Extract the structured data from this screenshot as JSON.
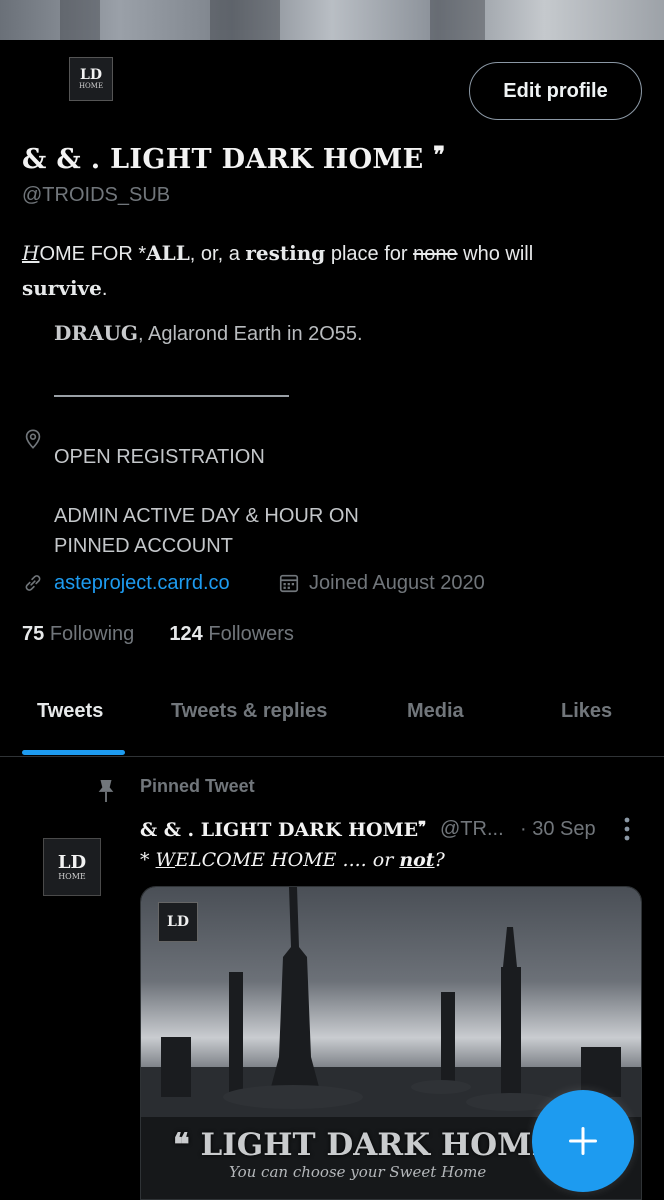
{
  "profile": {
    "avatar_text_large": "LD",
    "avatar_text_small": "HOME",
    "edit_button": "Edit profile",
    "name": "& & . LIGHT DARK HOME",
    "name_mark": "❞",
    "handle": "@TROIDS_SUB",
    "bio": {
      "l1_a": "H",
      "l1_b": "OME FOR *",
      "l1_c": "ALL",
      "l1_d": ", or, a ",
      "l1_e": "resting",
      "l1_f": " place for ",
      "l1_g": "none",
      "l1_h": " who will ",
      "l2_a": "survive",
      "l2_b": ".",
      "l3_a": "DRAUG",
      "l3_b": ",  Aglarond Earth  in  2O55.",
      "location_1": "OPEN REGISTRATION",
      "location_2": "ADMIN ACTIVE DAY & HOUR ON",
      "location_3": "PINNED ACCOUNT"
    },
    "link": "asteproject.carrd.co",
    "joined": "Joined August 2020",
    "following_count": "75",
    "following_label": "Following",
    "followers_count": "124",
    "followers_label": "Followers"
  },
  "tabs": [
    {
      "label": "Tweets",
      "active": true
    },
    {
      "label": "Tweets & replies",
      "active": false
    },
    {
      "label": "Media",
      "active": false
    },
    {
      "label": "Likes",
      "active": false
    }
  ],
  "pinned": {
    "label": "Pinned Tweet",
    "author": "& & . LIGHT DARK HOME",
    "author_mark": "❞",
    "handle": "@TR...",
    "date": "· 30 Sep",
    "text_a": "*  ",
    "text_b": "W",
    "text_c": "ELCOME  HOME  ....  or  ",
    "text_d": "not",
    "text_e": "?",
    "media": {
      "logo": "LD",
      "title": "❝ LIGHT DARK HOME",
      "subtitle": "You can choose your Sweet Home"
    }
  },
  "icons": {
    "location": "location-pin-icon",
    "link": "link-icon",
    "calendar": "calendar-icon",
    "pin": "pin-icon",
    "more": "more-vertical-icon",
    "compose": "plus-icon"
  },
  "colors": {
    "accent": "#1d9bf0",
    "background": "#000000",
    "muted": "#71767b"
  }
}
